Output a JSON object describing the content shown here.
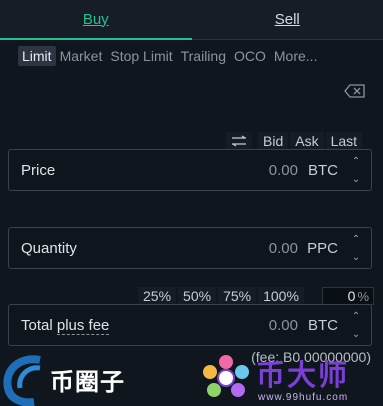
{
  "tabs": {
    "buy": "Buy",
    "sell": "Sell"
  },
  "order_types": [
    "Limit",
    "Market",
    "Stop Limit",
    "Trailing",
    "OCO",
    "More..."
  ],
  "price_refs": [
    "Bid",
    "Ask",
    "Last"
  ],
  "price": {
    "label": "Price",
    "value": "0.00",
    "unit": "BTC"
  },
  "quantity": {
    "label": "Quantity",
    "value": "0.00",
    "unit": "PPC"
  },
  "percents": [
    "25%",
    "50%",
    "75%",
    "100%"
  ],
  "percent_input": {
    "value": "0",
    "suffix": "%"
  },
  "total": {
    "label_prefix": "Total ",
    "label_underlined": "plus fee",
    "value": "0.00",
    "unit": "BTC"
  },
  "fee_text": "(fee: B0.00000000)",
  "watermark_left": "币圈子",
  "watermark_right": {
    "text": "币大师",
    "url": "www.99hufu.com"
  },
  "colors": {
    "accent": "#22c38e",
    "background": "#10161e",
    "watermark_purple": "#7b3fd8"
  }
}
